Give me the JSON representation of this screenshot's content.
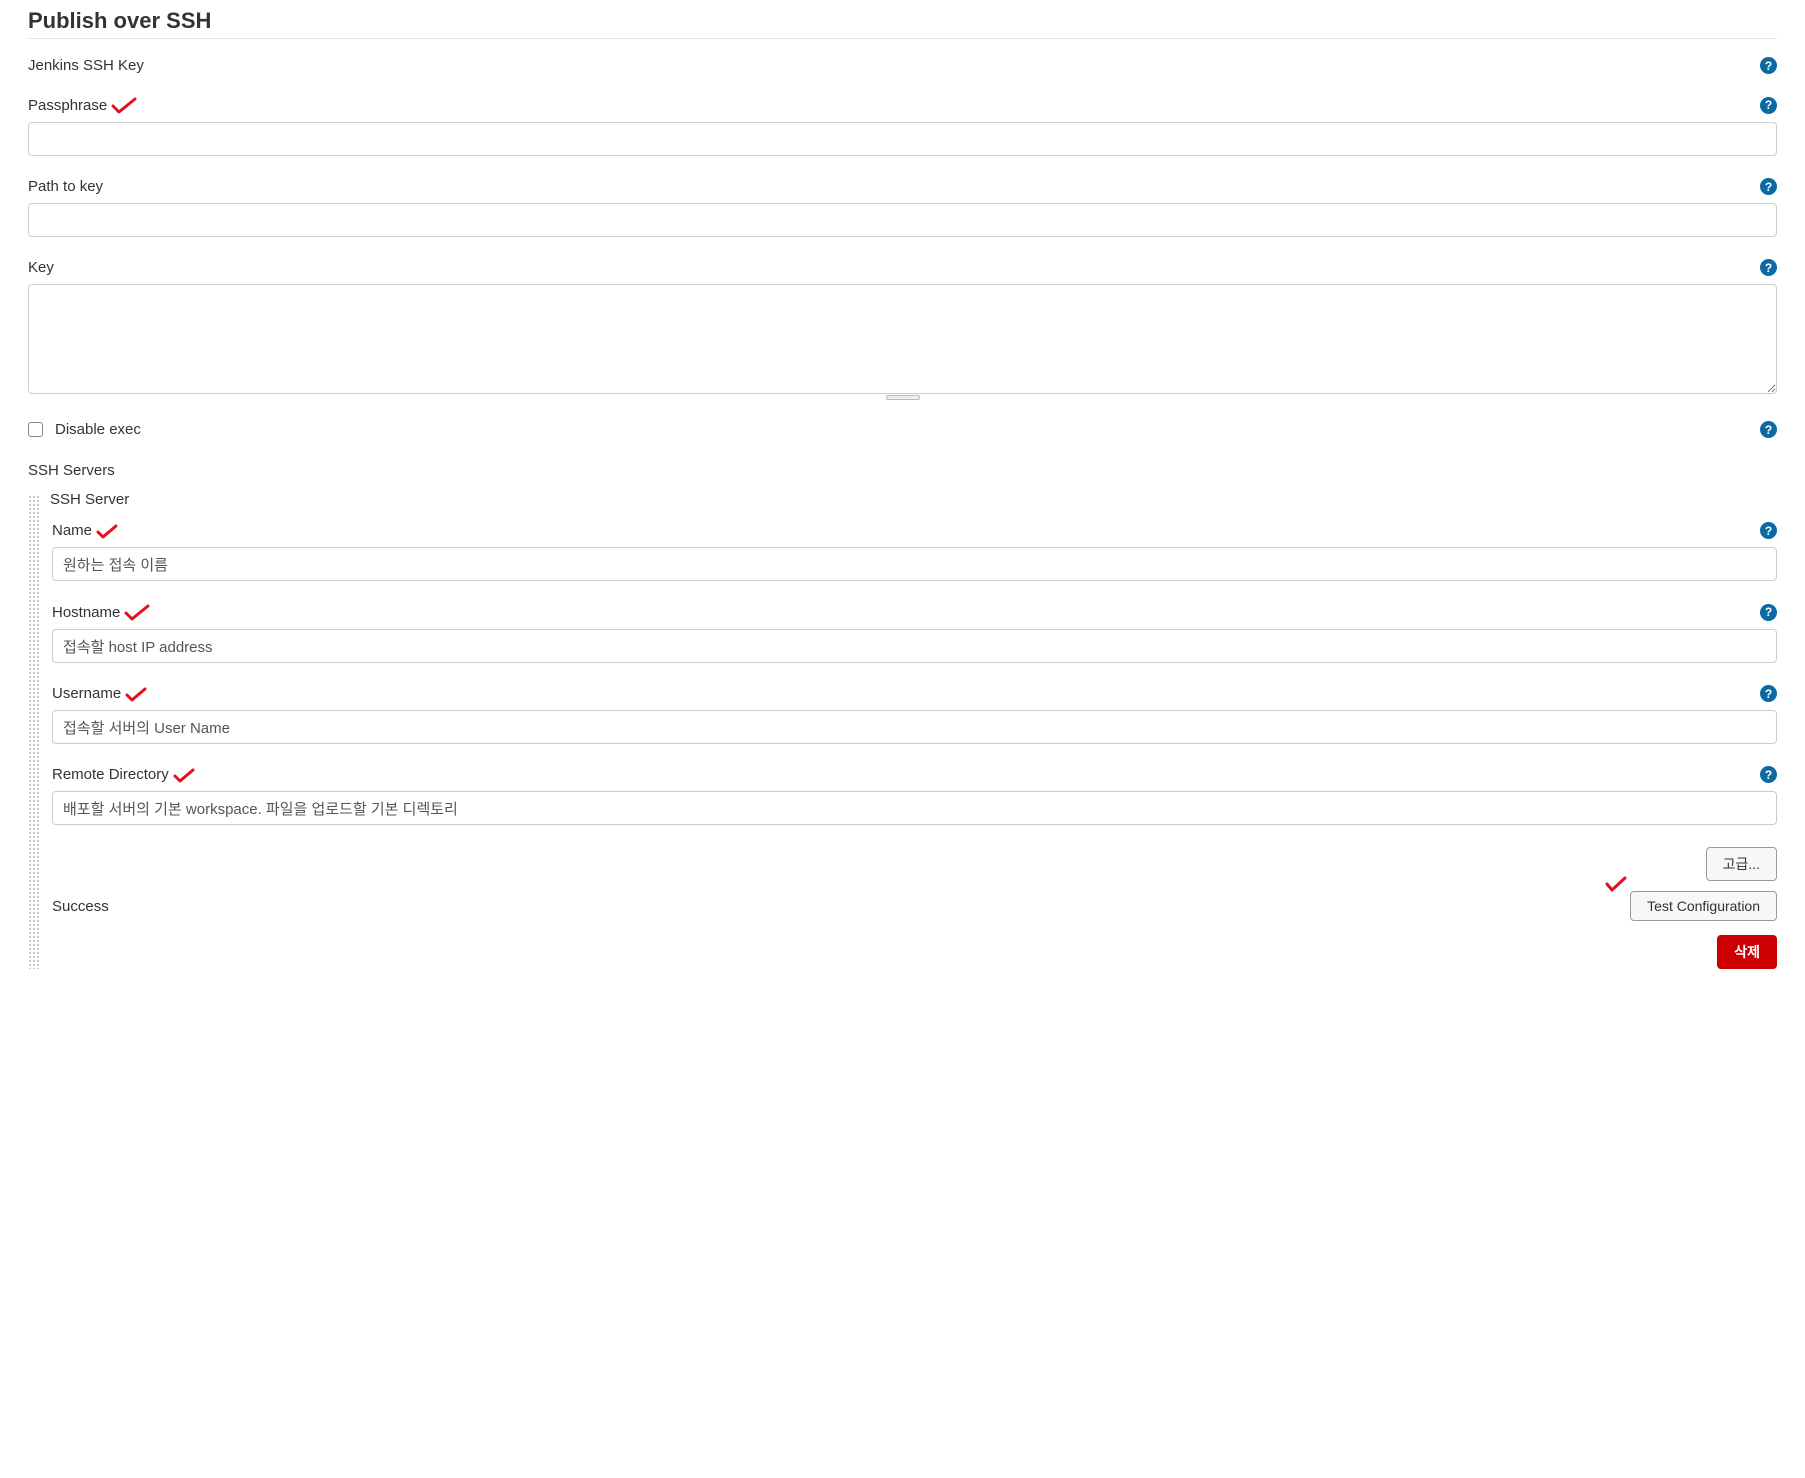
{
  "section_title": "Publish over SSH",
  "jenkins_key_label": "Jenkins SSH Key",
  "passphrase": {
    "label": "Passphrase",
    "value": ""
  },
  "path_to_key": {
    "label": "Path to key",
    "value": ""
  },
  "key": {
    "label": "Key",
    "value": ""
  },
  "disable_exec": {
    "label": "Disable exec",
    "checked": false
  },
  "ssh_servers_label": "SSH Servers",
  "ssh_server_label": "SSH Server",
  "server": {
    "name": {
      "label": "Name",
      "value": "원하는 접속 이름"
    },
    "hostname": {
      "label": "Hostname",
      "value": "접속할 host IP address"
    },
    "username": {
      "label": "Username",
      "value": "접속할 서버의 User Name"
    },
    "remote_dir": {
      "label": "Remote Directory",
      "value": "배포할 서버의 기본 workspace. 파일을 업로드할 기본 디렉토리"
    }
  },
  "buttons": {
    "advanced": "고급...",
    "test_config": "Test Configuration",
    "delete": "삭제"
  },
  "status": "Success",
  "help_glyph": "?"
}
